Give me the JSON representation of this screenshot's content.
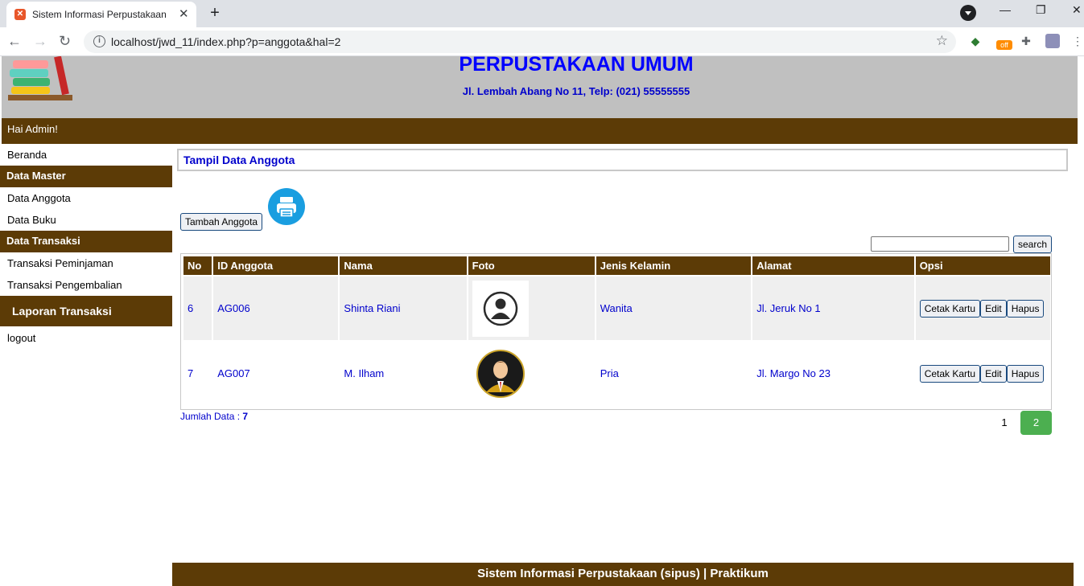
{
  "browser": {
    "tab_title": "Sistem Informasi Perpustakaan",
    "url": "localhost/jwd_11/index.php?p=anggota&hal=2"
  },
  "header": {
    "title": "PERPUSTAKAAN UMUM",
    "address": "Jl. Lembah Abang No 11, Telp: (021) 55555555",
    "welcome": "Hai Admin!"
  },
  "sidebar": {
    "beranda": "Beranda",
    "master_head": "Data Master",
    "anggota": "Data Anggota",
    "buku": "Data Buku",
    "transaksi_head": "Data Transaksi",
    "peminjaman": "Transaksi Peminjaman",
    "pengembalian": "Transaksi Pengembalian",
    "laporan_head": "Laporan Transaksi",
    "logout": "logout"
  },
  "content": {
    "title": "Tampil Data Anggota",
    "add_button": "Tambah Anggota",
    "search_button": "search",
    "search_value": "",
    "columns": [
      "No",
      "ID Anggota",
      "Nama",
      "Foto",
      "Jenis Kelamin",
      "Alamat",
      "Opsi"
    ],
    "rows": [
      {
        "no": "6",
        "id": "AG006",
        "nama": "Shinta Riani",
        "jk": "Wanita",
        "alamat": "Jl. Jeruk No 1"
      },
      {
        "no": "7",
        "id": "AG007",
        "nama": "M. Ilham",
        "jk": "Pria",
        "alamat": "Jl. Margo No 23"
      }
    ],
    "actions": {
      "cetak": "Cetak Kartu",
      "edit": "Edit",
      "hapus": "Hapus"
    },
    "jumlah_label": "Jumlah Data : ",
    "jumlah_value": "7",
    "pages": [
      "1",
      "2"
    ],
    "active_page": "2"
  },
  "footer": "Sistem Informasi Perpustakaan (sipus) | Praktikum",
  "colors": {
    "brown": "#5c3b06",
    "link_blue": "#0000cc",
    "active_page": "#4caf50"
  }
}
